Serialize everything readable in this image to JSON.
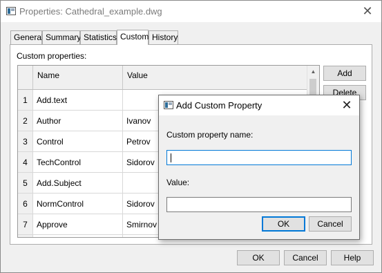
{
  "window": {
    "title": "Properties: Cathedral_example.dwg",
    "close_label": "✕"
  },
  "tabs": [
    {
      "label": "General"
    },
    {
      "label": "Summary"
    },
    {
      "label": "Statistics"
    },
    {
      "label": "Custom",
      "active": true
    },
    {
      "label": "History"
    }
  ],
  "custom": {
    "section_label": "Custom properties:",
    "columns": {
      "name": "Name",
      "value": "Value"
    },
    "rows": [
      {
        "num": "1",
        "name": "Add.text",
        "value": ""
      },
      {
        "num": "2",
        "name": "Author",
        "value": "Ivanov"
      },
      {
        "num": "3",
        "name": "Control",
        "value": "Petrov"
      },
      {
        "num": "4",
        "name": "TechControl",
        "value": "Sidorov"
      },
      {
        "num": "5",
        "name": "Add.Subject",
        "value": ""
      },
      {
        "num": "6",
        "name": "NormControl",
        "value": "Sidorov"
      },
      {
        "num": "7",
        "name": "Approve",
        "value": "Smirnov"
      }
    ],
    "add_label": "Add",
    "delete_label": "Delete"
  },
  "footer": {
    "ok_label": "OK",
    "cancel_label": "Cancel",
    "help_label": "Help"
  },
  "dialog": {
    "title": "Add Custom Property",
    "close_label": "✕",
    "name_label": "Custom property name:",
    "name_value": "",
    "value_label": "Value:",
    "value_value": "",
    "ok_label": "OK",
    "cancel_label": "Cancel"
  },
  "colors": {
    "focus_border": "#0078d7",
    "window_bg": "#f0f0f0"
  }
}
